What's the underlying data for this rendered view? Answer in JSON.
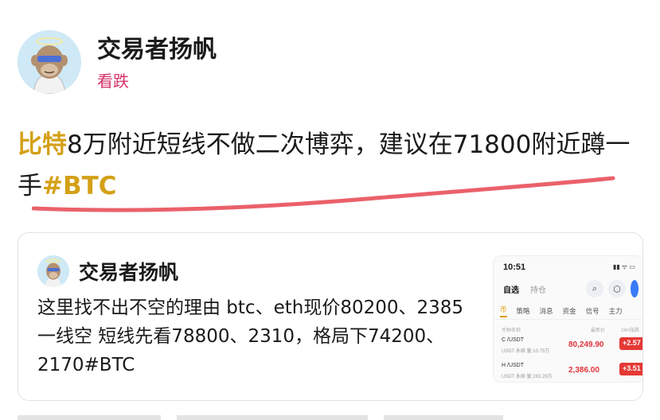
{
  "author": {
    "name": "交易者扬帆",
    "sentiment": "看跌"
  },
  "post": {
    "coin_link": "比特",
    "text_main": "8万附近短线不做二次博弈，建议在71800附近蹲一手",
    "hashtag": "#BTC"
  },
  "quoted_post": {
    "author_name": "交易者扬帆",
    "text": "这里找不出不空的理由 btc、eth现价80200、2385一线空 短线先看78800、2310，格局下74200、2170#BTC",
    "screenshot": {
      "time": "10:51",
      "tabs": [
        "自选",
        "持仓"
      ],
      "subtabs": [
        "币",
        "策略",
        "消息",
        "资金",
        "信号",
        "主力"
      ],
      "col_headers": [
        "币种名称",
        "最新价",
        "24H涨跌"
      ],
      "rows": [
        {
          "symbol": "C /USDT",
          "volume": "USDT 永续 量:10.75万",
          "price": "80,249.90",
          "change": "+2.57"
        },
        {
          "symbol": "H /USDT",
          "volume": "USDT 永续 量:263.28万",
          "price": "2,386.00",
          "change": "+3.51"
        }
      ]
    }
  },
  "colors": {
    "sentiment": "#d6336c",
    "link_gold": "#d4a017",
    "underline_red": "#e8505b",
    "price_red": "#e0343a"
  }
}
